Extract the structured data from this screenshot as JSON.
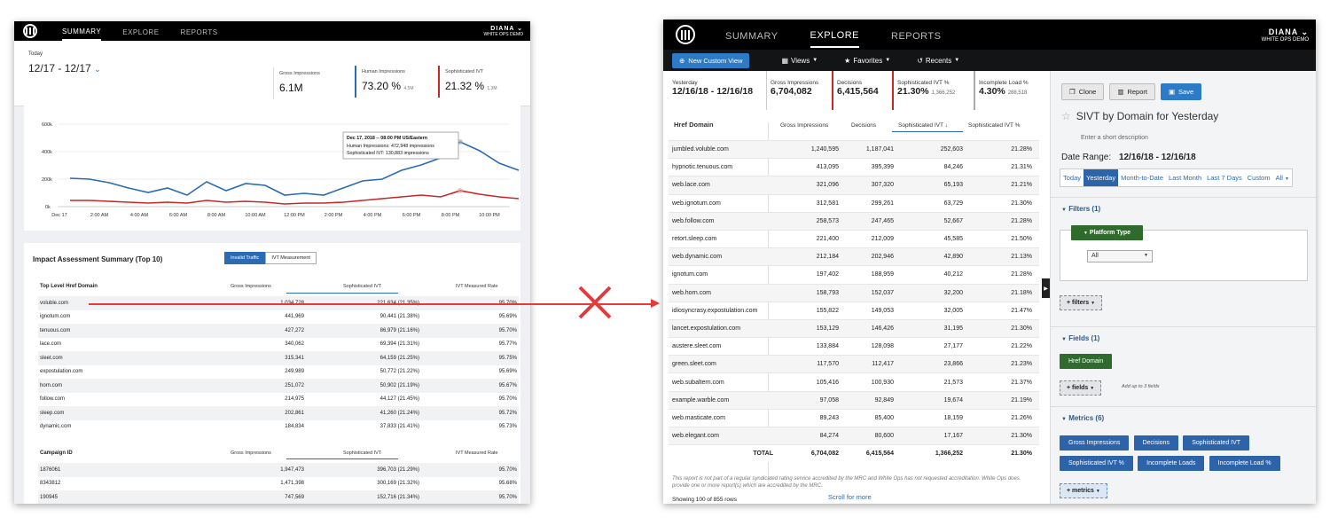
{
  "left": {
    "nav": [
      "SUMMARY",
      "EXPLORE",
      "REPORTS"
    ],
    "user": {
      "name": "DIANA",
      "org": "WHITE OPS DEMO"
    },
    "date": {
      "label": "Today",
      "range": "12/17 - 12/17",
      "chevron": "⌄"
    },
    "kpis": [
      {
        "label": "Gross Impressions",
        "value": "6.1M",
        "sub": ""
      },
      {
        "label": "Human Impressions",
        "value": "73.20 %",
        "sub": "4.5M"
      },
      {
        "label": "Sophisticated IVT",
        "value": "21.32 %",
        "sub": "1.3M"
      }
    ],
    "chart": {
      "y_ticks": [
        "600k",
        "400k",
        "200k",
        "0k"
      ],
      "x_ticks": [
        "Dec 17",
        "2:00 AM",
        "4:00 AM",
        "6:00 AM",
        "8:00 AM",
        "10:00 AM",
        "12:00 PM",
        "2:00 PM",
        "4:00 PM",
        "6:00 PM",
        "8:00 PM",
        "10:00 PM"
      ],
      "tooltip": {
        "title": "Dec 17, 2018 -- 08:00 PM US/Eastern",
        "line1": "Human Impressions: 472,948 impressions",
        "line2": "Sophisticated IVT: 130,883 impressions"
      }
    },
    "impact": {
      "title": "Impact Assessment Summary (Top 10)",
      "toggle": [
        "Invalid Traffic",
        "IVT Measurement"
      ],
      "headers": [
        "Top Level Href Domain",
        "Gross Impressions",
        "Sophisticated IVT",
        "IVT Measured Rate"
      ],
      "rows": [
        [
          "voluble.com",
          "1,034,728",
          "221,634 (21.35%)",
          "95.70%"
        ],
        [
          "ignotum.com",
          "441,969",
          "90,441 (21.38%)",
          "95.69%"
        ],
        [
          "tenuous.com",
          "427,272",
          "86,979 (21.16%)",
          "95.70%"
        ],
        [
          "lace.com",
          "340,062",
          "69,394 (21.31%)",
          "95.77%"
        ],
        [
          "sleet.com",
          "315,341",
          "64,159 (21.25%)",
          "95.75%"
        ],
        [
          "expostulation.com",
          "249,989",
          "50,772 (21.22%)",
          "95.69%"
        ],
        [
          "horn.com",
          "251,072",
          "50,902 (21.19%)",
          "95.67%"
        ],
        [
          "follow.com",
          "214,975",
          "44,127 (21.45%)",
          "95.70%"
        ],
        [
          "sleep.com",
          "202,861",
          "41,260 (21.24%)",
          "95.72%"
        ],
        [
          "dynamic.com",
          "184,834",
          "37,833 (21.41%)",
          "95.73%"
        ]
      ]
    },
    "campaign": {
      "headers": [
        "Campaign ID",
        "Gross Impressions",
        "Sophisticated IVT",
        "IVT Measured Rate"
      ],
      "rows": [
        [
          "1876061",
          "1,947,473",
          "396,703 (21.29%)",
          "95.70%"
        ],
        [
          "8343812",
          "1,471,398",
          "300,169 (21.32%)",
          "95.68%"
        ],
        [
          "190945",
          "747,569",
          "152,716 (21.34%)",
          "95.70%"
        ]
      ]
    }
  },
  "right": {
    "nav": [
      "SUMMARY",
      "EXPLORE",
      "REPORTS"
    ],
    "user": {
      "name": "DIANA",
      "org": "WHITE OPS DEMO"
    },
    "toolbar": {
      "new_view": "New Custom View",
      "views": "Views",
      "favorites": "Favorites",
      "recents": "Recents"
    },
    "kpis": [
      {
        "label": "Yesterday",
        "value": "12/16/18 - 12/16/18",
        "sub": ""
      },
      {
        "label": "Gross Impressions",
        "value": "6,704,082",
        "sub": ""
      },
      {
        "label": "Decisions",
        "value": "6,415,564",
        "sub": ""
      },
      {
        "label": "Sophisticated IVT %",
        "value": "21.30%",
        "sub": "1,366,252"
      },
      {
        "label": "Incomplete Load %",
        "value": "4.30%",
        "sub": "288,518"
      }
    ],
    "table": {
      "headers": [
        "Href Domain",
        "Gross Impressions",
        "Decisions",
        "Sophisticated IVT ↓",
        "Sophisticated IVT %"
      ],
      "rows": [
        [
          "jumbled.voluble.com",
          "1,240,595",
          "1,187,041",
          "252,603",
          "21.28%"
        ],
        [
          "hypnotic.tenuous.com",
          "413,095",
          "395,399",
          "84,246",
          "21.31%"
        ],
        [
          "web.lace.com",
          "321,096",
          "307,320",
          "65,193",
          "21.21%"
        ],
        [
          "web.ignotum.com",
          "312,581",
          "299,261",
          "63,729",
          "21.30%"
        ],
        [
          "web.follow.com",
          "258,573",
          "247,465",
          "52,667",
          "21.28%"
        ],
        [
          "retort.sleep.com",
          "221,400",
          "212,009",
          "45,585",
          "21.50%"
        ],
        [
          "web.dynamic.com",
          "212,184",
          "202,946",
          "42,890",
          "21.13%"
        ],
        [
          "ignotum.com",
          "197,402",
          "188,959",
          "40,212",
          "21.28%"
        ],
        [
          "web.horn.com",
          "158,793",
          "152,037",
          "32,200",
          "21.18%"
        ],
        [
          "idiosyncrasy.expostulation.com",
          "155,822",
          "149,053",
          "32,005",
          "21.47%"
        ],
        [
          "lancet.expostulation.com",
          "153,129",
          "146,426",
          "31,195",
          "21.30%"
        ],
        [
          "austere.sleet.com",
          "133,884",
          "128,098",
          "27,177",
          "21.22%"
        ],
        [
          "green.sleet.com",
          "117,570",
          "112,417",
          "23,866",
          "21.23%"
        ],
        [
          "web.subaltern.com",
          "105,416",
          "100,930",
          "21,573",
          "21.37%"
        ],
        [
          "example.warble.com",
          "97,058",
          "92,849",
          "19,674",
          "21.19%"
        ],
        [
          "web.masticate.com",
          "89,243",
          "85,400",
          "18,159",
          "21.26%"
        ],
        [
          "web.elegant.com",
          "84,274",
          "80,600",
          "17,167",
          "21.30%"
        ]
      ],
      "total": [
        "TOTAL",
        "6,704,082",
        "6,415,564",
        "1,366,252",
        "21.30%"
      ],
      "showing": "Showing 100 of 855 rows",
      "scroll": "Scroll for more",
      "note": "This report is not part of a regular syndicated rating service accredited by the MRC and White Ops has not requested accreditation. White Ops does provide one or more report(s) which are accredited by the MRC."
    },
    "panel": {
      "buttons": {
        "clone": "Clone",
        "report": "Report",
        "save": "Save"
      },
      "title": "SIVT by Domain for Yesterday",
      "description_placeholder": "Enter a short description",
      "date_range_label": "Date Range:",
      "date_range_value": "12/16/18 - 12/16/18",
      "date_tabs": [
        "Today",
        "Yesterday",
        "Month-to-Date",
        "Last Month",
        "Last 7 Days",
        "Custom",
        "All"
      ],
      "filters_title": "Filters (1)",
      "platform_type": "Platform Type",
      "platform_value": "All",
      "filters_add": "+ filters",
      "fields_title": "Fields (1)",
      "field_pill": "Href Domain",
      "fields_add": "+ fields",
      "fields_hint": "Add up to 3 fields",
      "metrics_title": "Metrics (6)",
      "metric_pills": [
        "Gross Impressions",
        "Decisions",
        "Sophisticated IVT",
        "Sophisticated IVT %",
        "Incomplete Loads",
        "Incomplete Load %"
      ],
      "metrics_add": "+ metrics"
    }
  },
  "colors": {
    "accent": "#2a6bb3",
    "human_series": "#2a6bb3",
    "sivt_series": "#c62828",
    "arrow": "#e23b3b",
    "green_pill": "#2e6b2d"
  }
}
